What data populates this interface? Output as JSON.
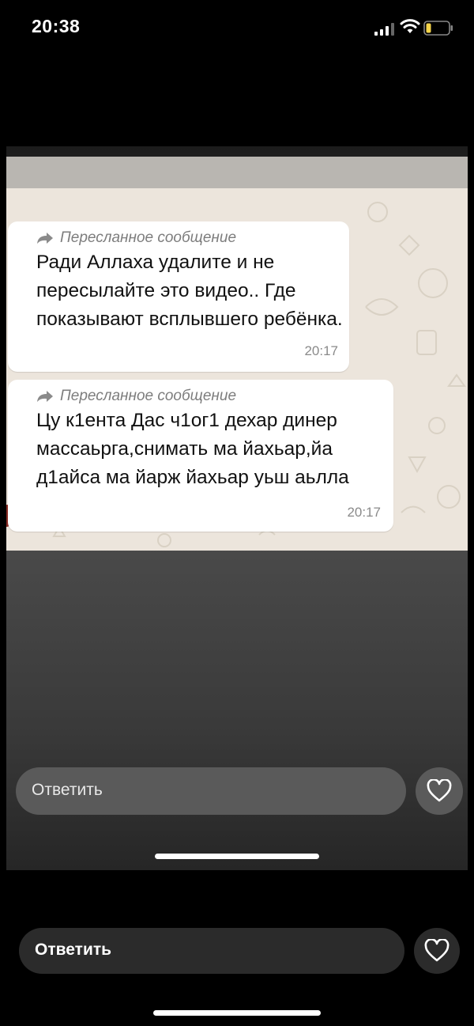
{
  "status_bar": {
    "time": "20:38"
  },
  "chat": {
    "messages": [
      {
        "forwarded_label": "Пересланное сообщение",
        "text": "Ради Аллаха удалите и не пересылайте это видео.. Где показывают всплывшего ребёнка.",
        "time": "20:17"
      },
      {
        "forwarded_label": "Пересланное сообщение",
        "text": "Цу к1ента Дас ч1ог1 дехар динер массаьрга,снимать ма йахьар,йа д1айса ма йарж йахьар уьш аьлла",
        "time": "20:17"
      }
    ]
  },
  "story_reply": {
    "placeholder": "Ответить"
  },
  "reply": {
    "placeholder": "Ответить"
  },
  "icons": {
    "forward": "forward-arrow-icon",
    "sticker": "sticker-icon",
    "camera": "camera-icon",
    "mic": "microphone-icon",
    "heart": "heart-icon"
  }
}
